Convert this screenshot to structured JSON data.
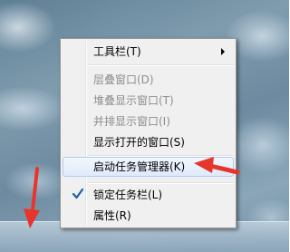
{
  "context_menu": {
    "items": [
      {
        "label": "工具栏(T)",
        "enabled": true,
        "has_submenu": true
      },
      {
        "label": "层叠窗口(D)",
        "enabled": false
      },
      {
        "label": "堆叠显示窗口(T)",
        "enabled": false
      },
      {
        "label": "并排显示窗口(I)",
        "enabled": false
      },
      {
        "label": "显示打开的窗口(S)",
        "enabled": true
      },
      {
        "label": "启动任务管理器(K)",
        "enabled": true,
        "highlighted": true
      },
      {
        "label": "锁定任务栏(L)",
        "enabled": true,
        "checked": true
      },
      {
        "label": "属性(R)",
        "enabled": true
      }
    ]
  },
  "annotation_color": "#e8352c",
  "check_color": "#1c5fa8"
}
